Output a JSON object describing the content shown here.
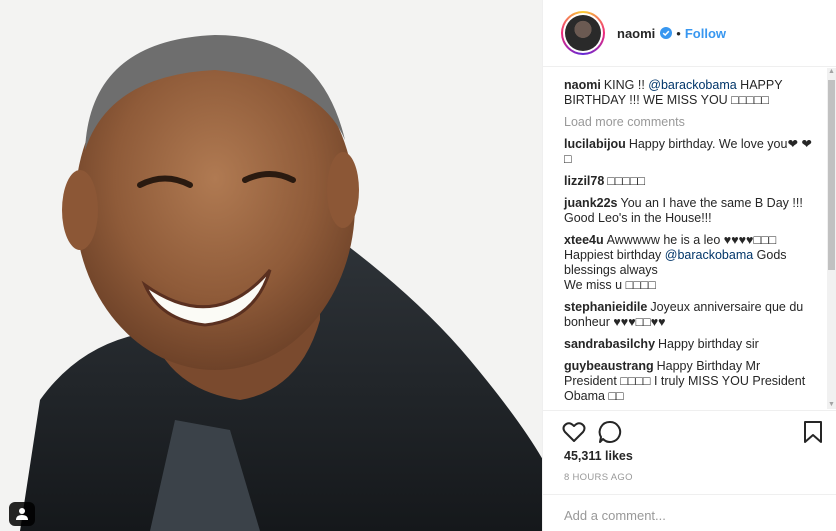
{
  "post": {
    "username": "naomi",
    "follow_label": "Follow",
    "dot": "•",
    "caption_user": "naomi",
    "caption_text": "KING !! ",
    "caption_mention": "@barackobama",
    "caption_rest": " HAPPY BIRTHDAY !!! WE MISS YOU □□□□□",
    "load_more": "Load more comments",
    "likes": "45,311 likes",
    "time": "8 HOURS AGO",
    "comment_placeholder": "Add a comment..."
  },
  "comments": [
    {
      "user": "lucilabijou",
      "text": "Happy birthday. We love you❤ ❤□"
    },
    {
      "user": "lizzil78",
      "text": "□□□□□"
    },
    {
      "user": "juank22s",
      "text": "You an I have the same B Day !!! Good Leo's in the House!!!"
    },
    {
      "user": "xtee4u",
      "text_before": "Awwwww he is a leo ♥♥♥♥□□□ Happiest birthday ",
      "mention": "@barackobama",
      "text_after": " Gods blessings always",
      "text_line2": "We miss u □□□□"
    },
    {
      "user": "stephanieidile",
      "text": "Joyeux anniversaire que du bonheur ♥♥♥□□♥♥"
    },
    {
      "user": "sandrabasilchy",
      "text": "Happy birthday sir"
    },
    {
      "user": "guybeaustrang",
      "text": "Happy Birthday Mr President □□□□ I truly MISS YOU President Obama □□"
    }
  ],
  "icons": {
    "like": "heart-icon",
    "comment": "comment-icon",
    "save": "bookmark-icon",
    "tag": "user-tag-icon",
    "verified": "verified-badge-icon"
  },
  "colors": {
    "link": "#3897f0",
    "mention": "#003569",
    "muted": "#999999"
  }
}
